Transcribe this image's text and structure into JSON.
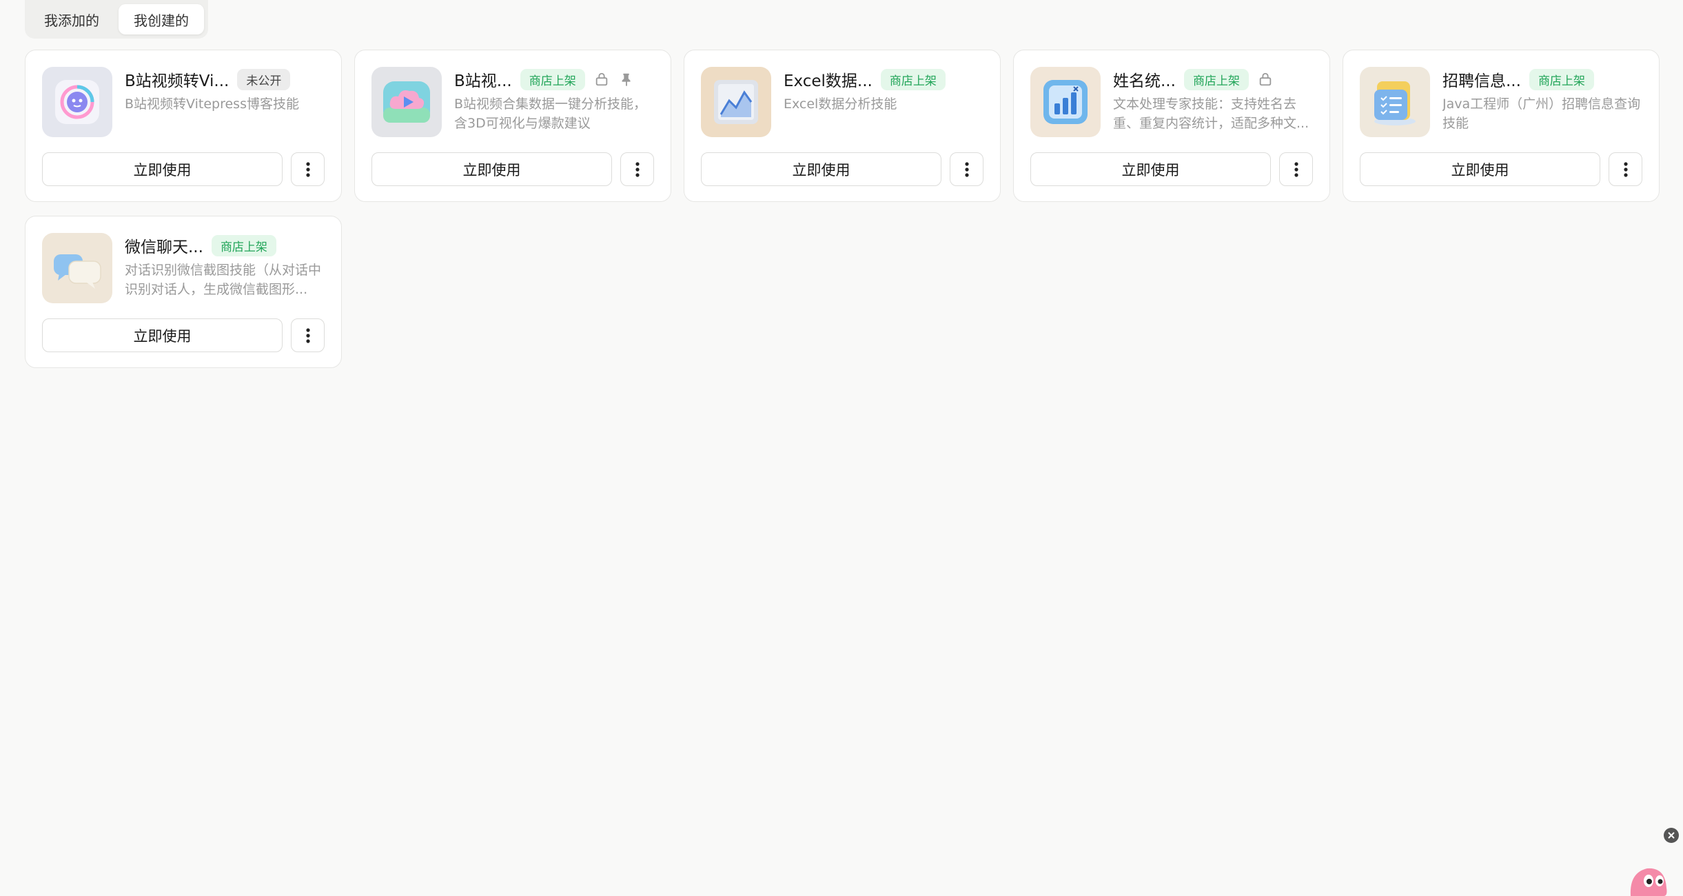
{
  "tabs": [
    {
      "label": "我添加的",
      "active": false
    },
    {
      "label": "我创建的",
      "active": true
    }
  ],
  "cards": [
    {
      "title": "B站视频转Vi...",
      "badge": "未公开",
      "badge_type": "private",
      "desc": "B站视频转Vitepress博客技能",
      "icon": "bilibili-convert-icon",
      "lock": false,
      "pin": false,
      "button": "立即使用"
    },
    {
      "title": "B站视...",
      "badge": "商店上架",
      "badge_type": "store",
      "desc": "B站视频合集数据一键分析技能，含3D可视化与爆款建议",
      "icon": "cloud-play-icon",
      "lock": true,
      "pin": true,
      "button": "立即使用"
    },
    {
      "title": "Excel数据...",
      "badge": "商店上架",
      "badge_type": "store",
      "desc": "Excel数据分析技能",
      "icon": "line-chart-icon",
      "lock": false,
      "pin": false,
      "button": "立即使用"
    },
    {
      "title": "姓名统...",
      "badge": "商店上架",
      "badge_type": "store",
      "desc": "文本处理专家技能：支持姓名去重、重复内容统计，适配多种文...",
      "icon": "bar-chart-icon",
      "lock": true,
      "pin": false,
      "button": "立即使用"
    },
    {
      "title": "招聘信息...",
      "badge": "商店上架",
      "badge_type": "store",
      "desc": "Java工程师（广州）招聘信息查询技能",
      "icon": "document-icon",
      "lock": false,
      "pin": false,
      "button": "立即使用"
    },
    {
      "title": "微信聊天...",
      "badge": "商店上架",
      "badge_type": "store",
      "desc": "对话识别微信截图技能（从对话中识别对话人，生成微信截图形...",
      "icon": "chat-bubbles-icon",
      "lock": false,
      "pin": false,
      "button": "立即使用"
    }
  ],
  "colors": {
    "store_badge_bg": "#e4f7ea",
    "store_badge_text": "#22a559",
    "private_badge_bg": "#ececec"
  }
}
